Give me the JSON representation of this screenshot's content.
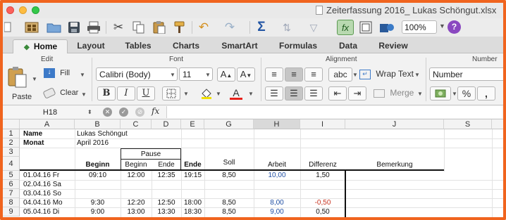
{
  "window": {
    "title": "Zeiterfassung 2016_ Lukas Schöngut.xlsx"
  },
  "toolbar": {
    "zoom": "100%",
    "help": "?"
  },
  "tabs": [
    "Home",
    "Layout",
    "Tables",
    "Charts",
    "SmartArt",
    "Formulas",
    "Data",
    "Review"
  ],
  "ribbon": {
    "groups": {
      "edit": "Edit",
      "font": "Font",
      "alignment": "Alignment",
      "number": "Number"
    },
    "paste": "Paste",
    "fill": "Fill",
    "clear": "Clear",
    "font_name": "Calibri (Body)",
    "font_size": "11",
    "bold": "B",
    "italic": "I",
    "underline": "U",
    "text_orientation": "abc",
    "wrap_text": "Wrap Text",
    "merge": "Merge",
    "number_format": "Number",
    "percent": "%",
    "comma": ","
  },
  "formula_bar": {
    "name_box": "H18",
    "fx": "fx"
  },
  "columns": [
    "A",
    "B",
    "C",
    "D",
    "E",
    "G",
    "H",
    "I",
    "J",
    "S"
  ],
  "rows": [
    "1",
    "2",
    "3",
    "4",
    "5",
    "6",
    "7",
    "8",
    "9"
  ],
  "cells": {
    "a1": "Name",
    "b1": "Lukas Schöngut",
    "a2": "Monat",
    "b2": "April 2016",
    "pause": "Pause",
    "b4": "Beginn",
    "c4": "Beginn",
    "d4": "Ende",
    "e4": "Ende",
    "g4": "Soll",
    "h4": "Arbeit",
    "i4": "Differenz",
    "j4": "Bemerkung",
    "a5": "01.04.16 Fr",
    "b5": "09:10",
    "c5": "12:00",
    "d5": "12:35",
    "e5": "19:15",
    "g5": "8,50",
    "h5": "10,00",
    "i5": "1,50",
    "a6": "02.04.16 Sa",
    "a7": "03.04.16 So",
    "a8": "04.04.16 Mo",
    "b8": "9:30",
    "c8": "12:20",
    "d8": "12:50",
    "e8": "18:00",
    "g8": "8,50",
    "h8": "8,00",
    "i8": "-0,50",
    "a9": "05.04.16 Di",
    "b9": "9:00",
    "c9": "13:00",
    "d9": "13:30",
    "e9": "18:30",
    "g9": "8,50",
    "h9": "9,00",
    "i9": "0,50"
  },
  "colors": {
    "frame": "#f0641e",
    "blue_values": "#1f4ea3",
    "negative": "#c8321e",
    "help": "#8a48c0"
  }
}
